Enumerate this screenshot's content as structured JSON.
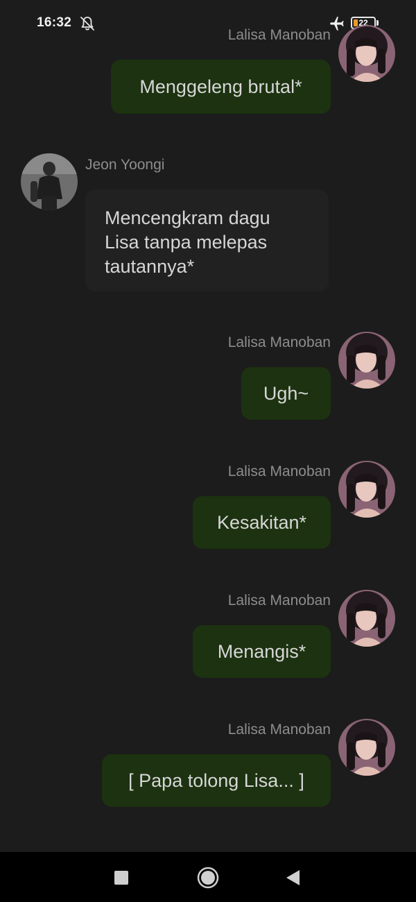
{
  "status_bar": {
    "time": "16:32",
    "battery_level": "22",
    "battery_fraction": 0.22,
    "battery_color": "#e89a28",
    "icons": [
      "bell-off-icon",
      "airplane-mode-icon",
      "battery-icon"
    ]
  },
  "colors": {
    "background": "#1c1c1c",
    "outgoing_bubble": "#1c3210",
    "incoming_bubble": "#212121",
    "name_text": "#8d8d8d",
    "message_text": "#d6d6d6"
  },
  "messages": [
    {
      "sender": "Lalisa Manoban",
      "side": "right",
      "text": "Menggeleng brutal*"
    },
    {
      "sender": "Jeon Yoongi",
      "side": "left",
      "text": "Mencengkram dagu Lisa tanpa melepas tautannya*"
    },
    {
      "sender": "Lalisa Manoban",
      "side": "right",
      "text": "Ugh~"
    },
    {
      "sender": "Lalisa Manoban",
      "side": "right",
      "text": "Kesakitan*"
    },
    {
      "sender": "Lalisa Manoban",
      "side": "right",
      "text": "Menangis*"
    },
    {
      "sender": "Lalisa Manoban",
      "side": "right",
      "text": "[ Papa tolong Lisa... ]"
    }
  ],
  "nav_bar": {
    "icons": [
      "recents-square-icon",
      "home-circle-icon",
      "back-triangle-icon"
    ]
  }
}
